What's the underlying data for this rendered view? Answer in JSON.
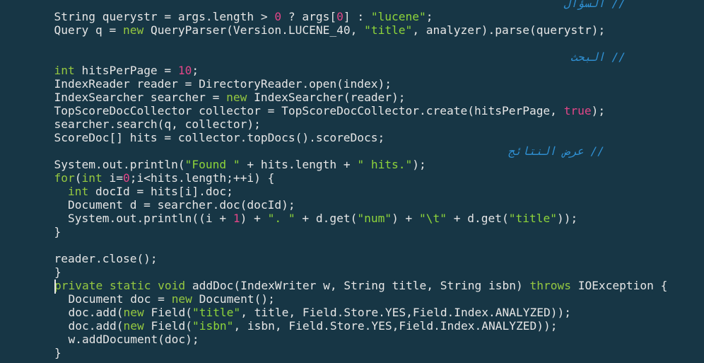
{
  "theme": {
    "background": "#173645",
    "text": "#e6e6e6",
    "keyword": "#95c840",
    "string": "#8ed43a",
    "number": "#e34688",
    "comment": "#2f8fd1"
  },
  "comments": [
    "// السؤال",
    "// البحث",
    "// عرض النتائج"
  ],
  "lines": [
    [
      [
        "t",
        "  String querystr = args.length > "
      ],
      [
        "n",
        "0"
      ],
      [
        "t",
        " ? args["
      ],
      [
        "n",
        "0"
      ],
      [
        "t",
        "] : "
      ],
      [
        "s",
        "\"lucene\""
      ],
      [
        "t",
        ";"
      ]
    ],
    [
      [
        "t",
        "  Query q = "
      ],
      [
        "k",
        "new"
      ],
      [
        "t",
        " QueryParser(Version.LUCENE_40, "
      ],
      [
        "s",
        "\"title\""
      ],
      [
        "t",
        ", analyzer).parse(querystr);"
      ]
    ],
    [
      [
        "k",
        "  int"
      ],
      [
        "t",
        " hitsPerPage = "
      ],
      [
        "n",
        "10"
      ],
      [
        "t",
        ";"
      ]
    ],
    [
      [
        "t",
        "  IndexReader reader = DirectoryReader.open(index);"
      ]
    ],
    [
      [
        "t",
        "  IndexSearcher searcher = "
      ],
      [
        "k",
        "new"
      ],
      [
        "t",
        " IndexSearcher(reader);"
      ]
    ],
    [
      [
        "t",
        "  TopScoreDocCollector collector = TopScoreDocCollector.create(hitsPerPage, "
      ],
      [
        "n",
        "true"
      ],
      [
        "t",
        ");"
      ]
    ],
    [
      [
        "t",
        "  searcher.search(q, collector);"
      ]
    ],
    [
      [
        "t",
        "  ScoreDoc[] hits = collector.topDocs().scoreDocs;"
      ]
    ],
    [
      [
        "t",
        "  System.out.println("
      ],
      [
        "s",
        "\"Found \""
      ],
      [
        "t",
        " + hits.length + "
      ],
      [
        "s",
        "\" hits.\""
      ],
      [
        "t",
        ");"
      ]
    ],
    [
      [
        "k",
        "  for"
      ],
      [
        "t",
        "("
      ],
      [
        "k",
        "int"
      ],
      [
        "t",
        " i="
      ],
      [
        "n",
        "0"
      ],
      [
        "t",
        ";i<hits.length;++i) {"
      ]
    ],
    [
      [
        "k",
        "    int"
      ],
      [
        "t",
        " docId = hits[i].doc;"
      ]
    ],
    [
      [
        "t",
        "    Document d = searcher.doc(docId);"
      ]
    ],
    [
      [
        "t",
        "    System.out.println((i + "
      ],
      [
        "n",
        "1"
      ],
      [
        "t",
        ") + "
      ],
      [
        "s",
        "\". \""
      ],
      [
        "t",
        " + d.get("
      ],
      [
        "s",
        "\"num\""
      ],
      [
        "t",
        ") + "
      ],
      [
        "s",
        "\"\\t\""
      ],
      [
        "t",
        " + d.get("
      ],
      [
        "s",
        "\"title\""
      ],
      [
        "t",
        "));"
      ]
    ],
    [
      [
        "t",
        "  }"
      ]
    ],
    [
      [
        "t",
        "  reader.close();"
      ]
    ],
    [
      [
        "t",
        "}"
      ]
    ],
    [
      [
        "k",
        "private static void"
      ],
      [
        "t",
        " addDoc(IndexWriter w, String title, String isbn) "
      ],
      [
        "k",
        "throws"
      ],
      [
        "t",
        " IOException {"
      ]
    ],
    [
      [
        "t",
        "  Document doc = "
      ],
      [
        "k",
        "new"
      ],
      [
        "t",
        " Document();"
      ]
    ],
    [
      [
        "t",
        "  doc.add("
      ],
      [
        "k",
        "new"
      ],
      [
        "t",
        " Field("
      ],
      [
        "s",
        "\"title\""
      ],
      [
        "t",
        ", title, Field.Store.YES,Field.Index.ANALYZED));"
      ]
    ],
    [
      [
        "t",
        "  doc.add("
      ],
      [
        "k",
        "new"
      ],
      [
        "t",
        " Field("
      ],
      [
        "s",
        "\"isbn\""
      ],
      [
        "t",
        ", isbn, Field.Store.YES,Field.Index.ANALYZED));"
      ]
    ],
    [
      [
        "t",
        "  w.addDocument(doc);"
      ]
    ],
    [
      [
        "t",
        "}"
      ]
    ]
  ]
}
